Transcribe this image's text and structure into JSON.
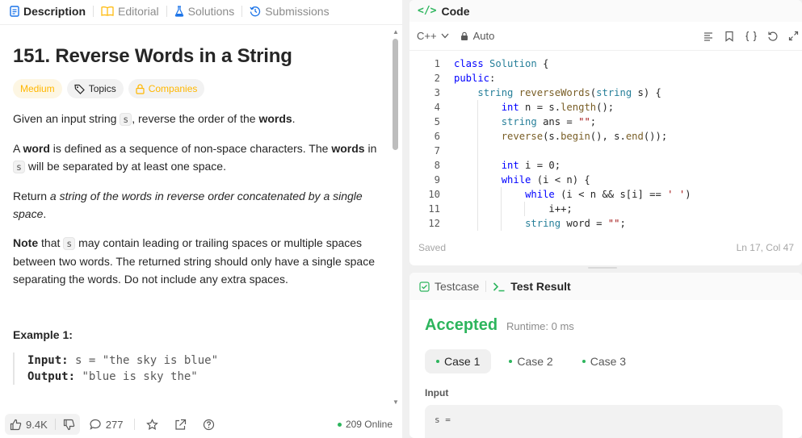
{
  "left_tabs": [
    {
      "label": "Description",
      "icon": "description-icon"
    },
    {
      "label": "Editorial",
      "icon": "book-icon"
    },
    {
      "label": "Solutions",
      "icon": "flask-icon"
    },
    {
      "label": "Submissions",
      "icon": "history-icon"
    }
  ],
  "problem": {
    "title": "151. Reverse Words in a String",
    "difficulty": "Medium",
    "topics_label": "Topics",
    "companies_label": "Companies",
    "p1_a": "Given an input string ",
    "p1_code": "s",
    "p1_b": ", reverse the order of the ",
    "p1_bold": "words",
    "p1_c": ".",
    "p2_a": "A ",
    "p2_bold1": "word",
    "p2_b": " is defined as a sequence of non-space characters. The ",
    "p2_bold2": "words",
    "p2_c": " in ",
    "p2_code": "s",
    "p2_d": " will be separated by at least one space.",
    "p3_a": "Return ",
    "p3_em": "a string of the words in reverse order concatenated by a single space",
    "p3_b": ".",
    "p4_bold": "Note",
    "p4_a": " that ",
    "p4_code": "s",
    "p4_b": " may contain leading or trailing spaces or multiple spaces between two words. The returned string should only have a single space separating the words. Do not include any extra spaces.",
    "example_title": "Example 1:",
    "example_input_label": "Input:",
    "example_input": " s = \"the sky is blue\"",
    "example_output_label": "Output:",
    "example_output": " \"blue is sky the\""
  },
  "bottom_bar": {
    "likes": "9.4K",
    "comments": "277",
    "online": "209 Online"
  },
  "code_panel": {
    "title": "Code",
    "language": "C++",
    "mode": "Auto",
    "status_left": "Saved",
    "status_right": "Ln 17, Col 47",
    "lines": [
      {
        "n": "1",
        "text": "class Solution {"
      },
      {
        "n": "2",
        "text": "public:"
      },
      {
        "n": "3",
        "text": "    string reverseWords(string s) {"
      },
      {
        "n": "4",
        "text": "        int n = s.length();"
      },
      {
        "n": "5",
        "text": "        string ans = \"\";"
      },
      {
        "n": "6",
        "text": "        reverse(s.begin(), s.end());"
      },
      {
        "n": "7",
        "text": ""
      },
      {
        "n": "8",
        "text": "        int i = 0;"
      },
      {
        "n": "9",
        "text": "        while (i < n) {"
      },
      {
        "n": "10",
        "text": "            while (i < n && s[i] == ' ')"
      },
      {
        "n": "11",
        "text": "                i++;"
      },
      {
        "n": "12",
        "text": "            string word = \"\";"
      }
    ]
  },
  "result_panel": {
    "tab_testcase": "Testcase",
    "tab_result": "Test Result",
    "verdict": "Accepted",
    "runtime": "Runtime: 0 ms",
    "cases": [
      "Case 1",
      "Case 2",
      "Case 3"
    ],
    "input_label": "Input",
    "input_value": "s ="
  },
  "colors": {
    "accent_green": "#2db55d",
    "medium_yellow": "#ffb700"
  }
}
